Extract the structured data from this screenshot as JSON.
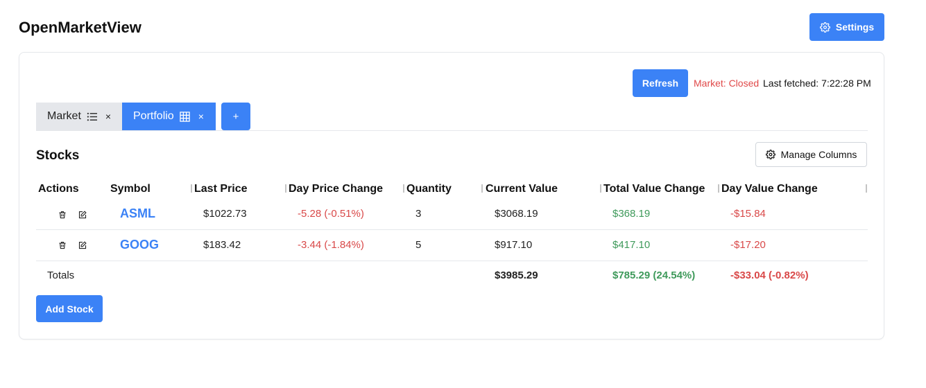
{
  "app": {
    "title": "OpenMarketView",
    "settings_label": "Settings"
  },
  "toolbar": {
    "refresh_label": "Refresh",
    "market_status": "Market: Closed",
    "last_fetched_label": "Last fetched:",
    "last_fetched_time": "7:22:28 PM"
  },
  "tabs": [
    {
      "label": "Market",
      "icon": "list-icon",
      "close": "×",
      "active": false
    },
    {
      "label": "Portfolio",
      "icon": "grid-icon",
      "close": "×",
      "active": true
    }
  ],
  "add_tab_label": "+",
  "section": {
    "title": "Stocks",
    "manage_columns_label": "Manage Columns"
  },
  "table": {
    "headers": [
      "Actions",
      "Symbol",
      "Last Price",
      "Day Price Change",
      "Quantity",
      "Current Value",
      "Total Value Change",
      "Day Value Change"
    ],
    "rows": [
      {
        "symbol": "ASML",
        "last_price": "$1022.73",
        "day_price_change": "-5.28 (-0.51%)",
        "quantity": "3",
        "current_value": "$3068.19",
        "total_value_change": "$368.19",
        "day_value_change": "-$15.84"
      },
      {
        "symbol": "GOOG",
        "last_price": "$183.42",
        "day_price_change": "-3.44 (-1.84%)",
        "quantity": "5",
        "current_value": "$917.10",
        "total_value_change": "$417.10",
        "day_value_change": "-$17.20"
      }
    ],
    "totals": {
      "label": "Totals",
      "current_value": "$3985.29",
      "total_value_change": "$785.29 (24.54%)",
      "day_value_change": "-$33.04 (-0.82%)"
    }
  },
  "add_stock_label": "Add Stock",
  "colors": {
    "accent": "#3b82f6",
    "negative": "#d94848",
    "positive": "#3f9a5b",
    "market_closed": "#e04848"
  }
}
